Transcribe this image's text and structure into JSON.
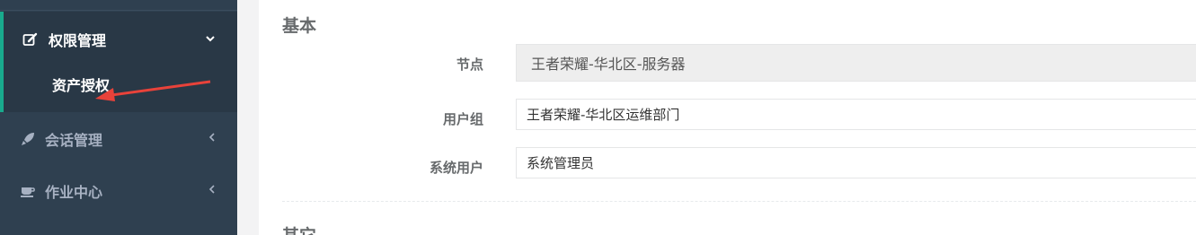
{
  "sidebar": {
    "items": [
      {
        "label": "权限管理",
        "icon": "edit-icon",
        "arrow": "chevron-down-icon"
      },
      {
        "label": "会话管理",
        "icon": "rocket-icon",
        "arrow": "chevron-left-icon"
      },
      {
        "label": "作业中心",
        "icon": "coffee-icon",
        "arrow": "chevron-left-icon"
      }
    ],
    "sub_items": [
      {
        "label": "资产授权"
      }
    ],
    "colors": {
      "background": "#2f4050",
      "active_background": "#293846",
      "accent": "#19aa8d"
    }
  },
  "annotation": {
    "color": "#e8423a",
    "icon": "red-arrow-annotation"
  },
  "form": {
    "section_basic": "基本",
    "section_other": "其它",
    "fields": [
      {
        "label": "节点",
        "value": "王者荣耀-华北区-服务器",
        "disabled": true
      },
      {
        "label": "用户组",
        "value": "王者荣耀-华北区运维部门"
      },
      {
        "label": "系统用户",
        "value": "系统管理员"
      }
    ]
  }
}
